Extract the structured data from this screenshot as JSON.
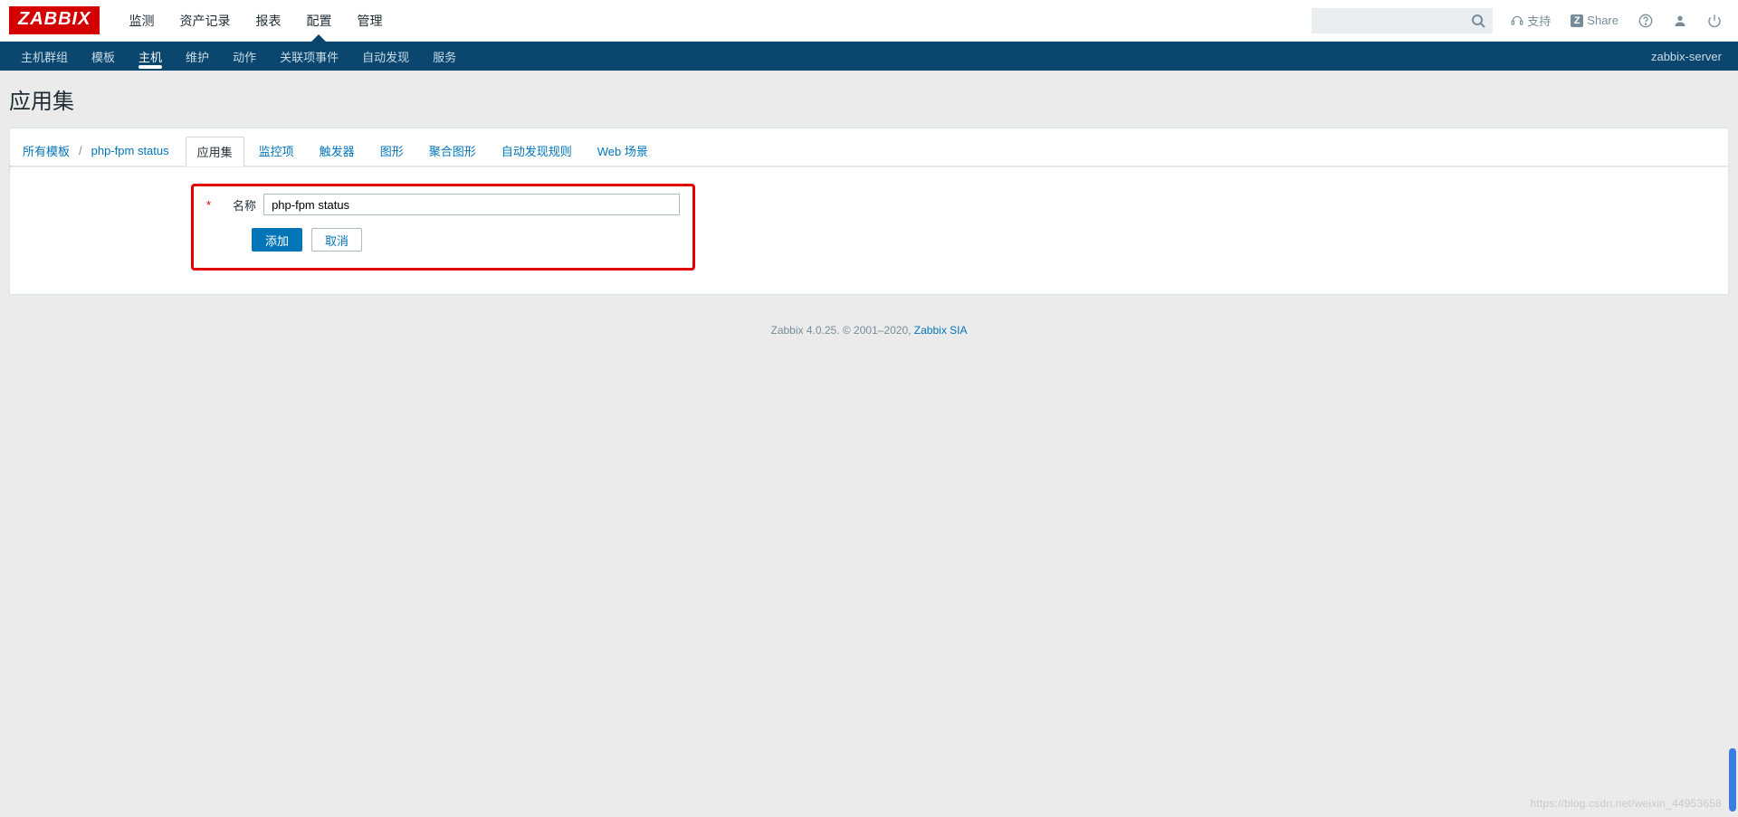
{
  "logo_text": "ZABBIX",
  "main_menu": {
    "items": [
      "监测",
      "资产记录",
      "报表",
      "配置",
      "管理"
    ],
    "active_index": 3
  },
  "top_right": {
    "search_placeholder": "",
    "support_label": "支持",
    "share_label": "Share"
  },
  "sub_nav": {
    "items": [
      "主机群组",
      "模板",
      "主机",
      "维护",
      "动作",
      "关联项事件",
      "自动发现",
      "服务"
    ],
    "active_index": 2,
    "server_name": "zabbix-server"
  },
  "page_title": "应用集",
  "breadcrumb": {
    "all_templates": "所有模板",
    "template_name": "php-fpm status"
  },
  "tabs": {
    "items": [
      "应用集",
      "监控项",
      "触发器",
      "图形",
      "聚合图形",
      "自动发现规则",
      "Web 场景"
    ],
    "active_index": 0
  },
  "form": {
    "name_label": "名称",
    "name_value": "php-fpm status",
    "add_button": "添加",
    "cancel_button": "取消"
  },
  "footer": {
    "text_prefix": "Zabbix 4.0.25. © 2001–2020, ",
    "link_text": "Zabbix SIA"
  },
  "watermark": "https://blog.csdn.net/weixin_44953658"
}
